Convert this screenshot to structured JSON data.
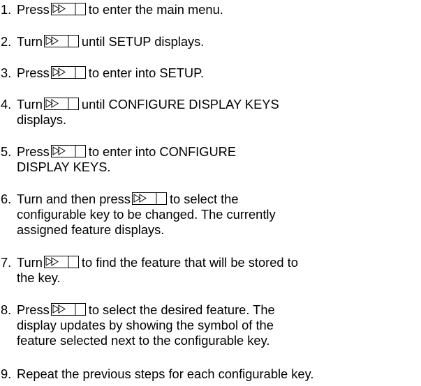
{
  "steps": [
    {
      "number": "1.",
      "verb": "Press",
      "icon": "play-pause-key-icon",
      "lines": [
        "to enter the main menu."
      ]
    },
    {
      "number": "2.",
      "verb": "Turn",
      "icon": "play-pause-key-icon",
      "lines": [
        "until SETUP displays."
      ]
    },
    {
      "number": "3.",
      "verb": "Press",
      "icon": "play-pause-key-icon",
      "lines": [
        "to enter into SETUP."
      ]
    },
    {
      "number": "4.",
      "verb": "Turn",
      "icon": "play-pause-key-icon",
      "lines": [
        "until CONFIGURE DISPLAY KEYS",
        "displays."
      ]
    },
    {
      "number": "5.",
      "verb": "Press",
      "icon": "play-pause-key-icon",
      "lines": [
        "to enter into CONFIGURE",
        "DISPLAY KEYS."
      ]
    },
    {
      "number": "6.",
      "verb": "Turn and then press",
      "icon": "play-pause-key-icon",
      "lines": [
        "to select the",
        "configurable key to be changed. The currently",
        "assigned feature displays."
      ]
    },
    {
      "number": "7.",
      "verb": "Turn",
      "icon": "play-pause-key-icon",
      "lines": [
        "to find the feature that will be stored to",
        "the key."
      ]
    },
    {
      "number": "8.",
      "verb": "Press",
      "icon": "play-pause-key-icon",
      "lines": [
        "to select the desired feature. The",
        "display updates by showing the symbol of the",
        "feature selected next to the configurable key."
      ]
    },
    {
      "number": "9.",
      "verb": "",
      "icon": "",
      "lines": [
        "Repeat the previous steps for each configurable key."
      ]
    }
  ]
}
